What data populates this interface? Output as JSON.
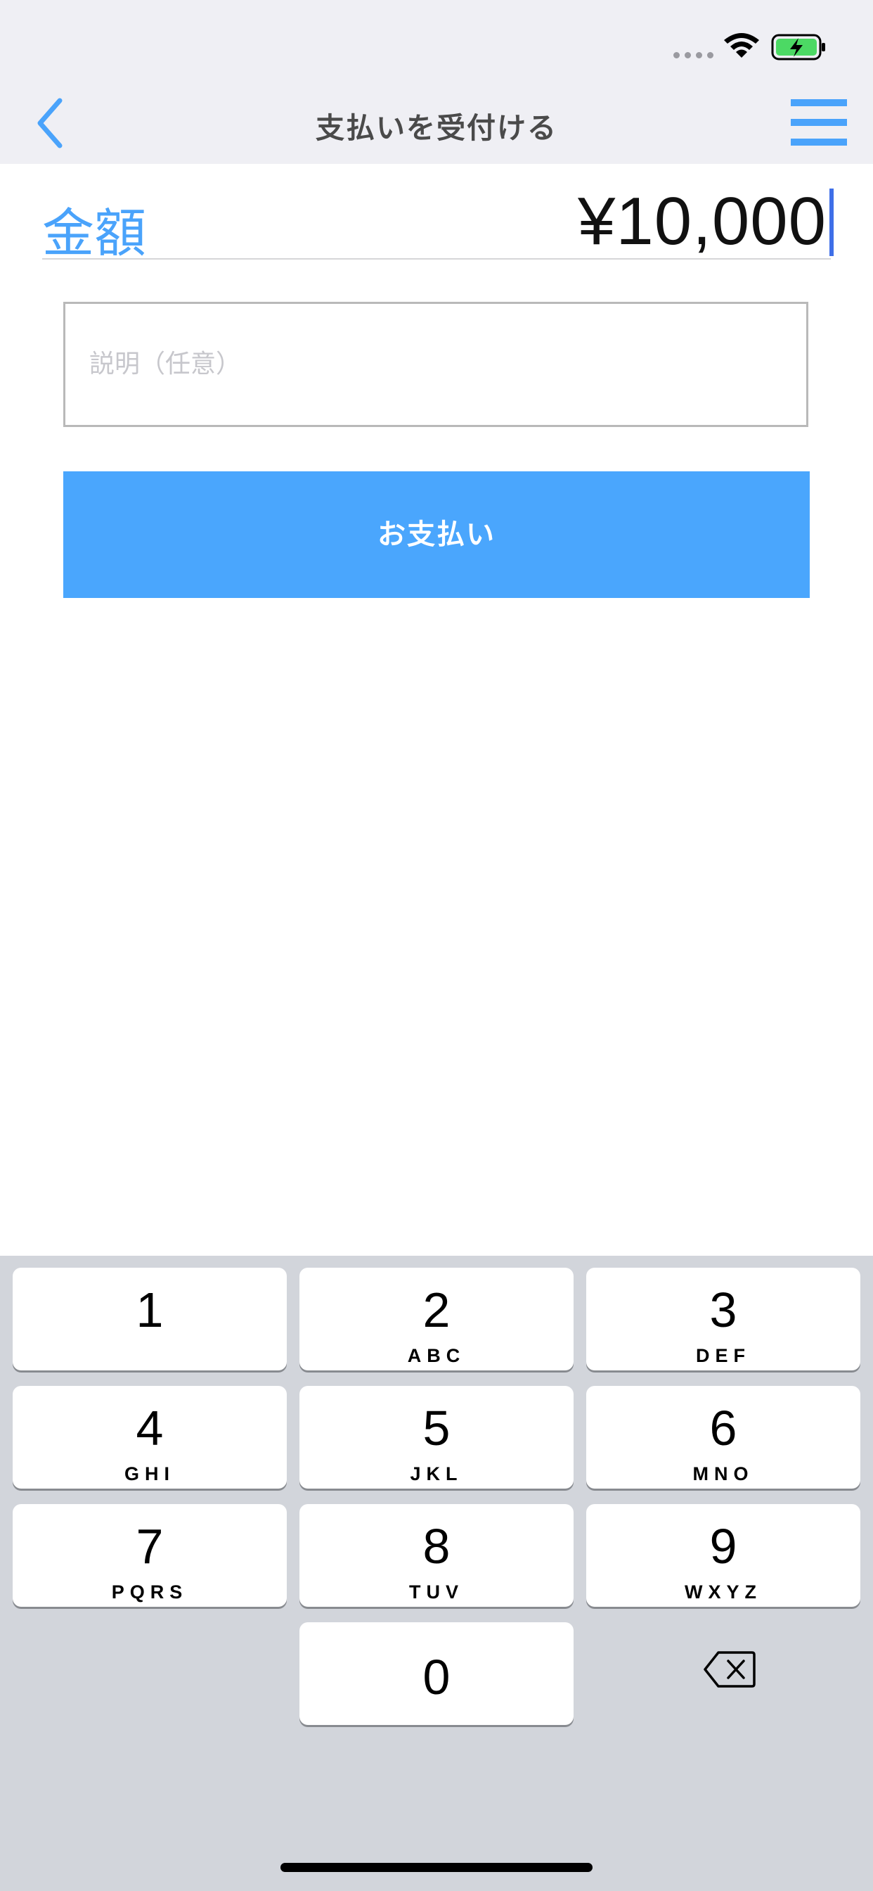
{
  "nav": {
    "title": "支払いを受付ける"
  },
  "amount": {
    "label": "金額",
    "value": "¥10,000"
  },
  "description": {
    "placeholder": "説明（任意）"
  },
  "pay_button": {
    "label": "お支払い"
  },
  "keypad": {
    "keys": [
      {
        "num": "1",
        "letters": ""
      },
      {
        "num": "2",
        "letters": "ABC"
      },
      {
        "num": "3",
        "letters": "DEF"
      },
      {
        "num": "4",
        "letters": "GHI"
      },
      {
        "num": "5",
        "letters": "JKL"
      },
      {
        "num": "6",
        "letters": "MNO"
      },
      {
        "num": "7",
        "letters": "PQRS"
      },
      {
        "num": "8",
        "letters": "TUV"
      },
      {
        "num": "9",
        "letters": "WXYZ"
      },
      {
        "num": "0",
        "letters": ""
      }
    ]
  },
  "colors": {
    "accent": "#4aa3fb",
    "topbar_bg": "#efeff4",
    "keyboard_bg": "#d2d5db",
    "battery_green": "#4cd964"
  }
}
